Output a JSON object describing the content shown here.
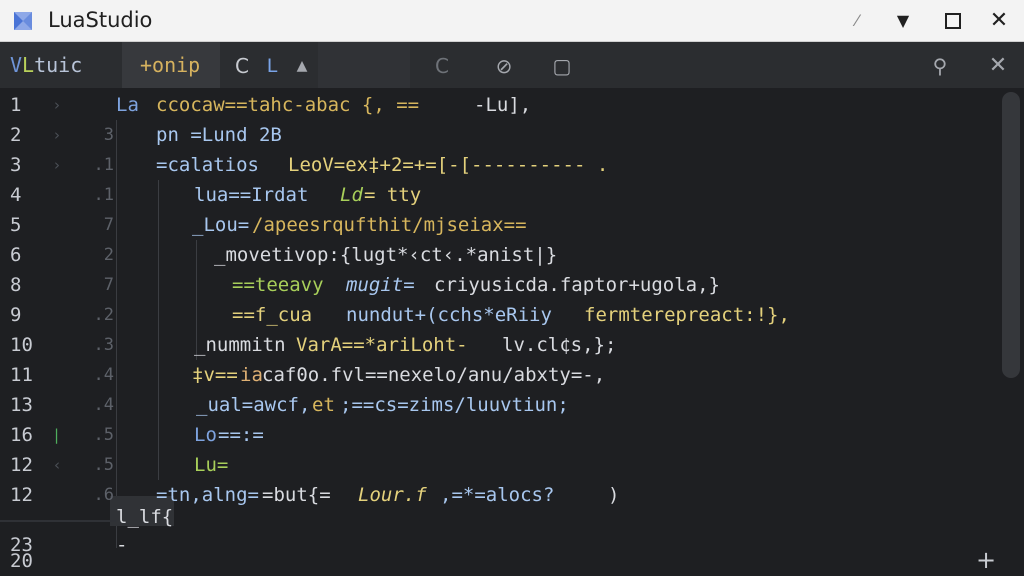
{
  "titlebar": {
    "title": "LuaStudio",
    "pin_glyph": "⁄",
    "dropdown_glyph": "▼",
    "close_glyph": "✕",
    "colors": {
      "background": "#f3f3f3",
      "logo_front": "#4a74d6",
      "logo_back": "#8ea8e8"
    }
  },
  "toolbar": {
    "tab_lua": {
      "v": "V",
      "lu": "L",
      "rest": "tuic"
    },
    "tab_active": "+onip",
    "tools": {
      "c_glyph": "C",
      "l_glyph": "L",
      "arrow_glyph": "▲",
      "undo_glyph": "C",
      "search_glyph": "⊘",
      "doc_glyph": "▢",
      "settings_glyph": "⚲",
      "close_glyph": "✕"
    }
  },
  "editor": {
    "rows": [
      {
        "ln": "1",
        "fold": "›",
        "sub": "",
        "segments": [
          "La",
          "ccocaw==tahc-abac {, ==",
          "-Lu],"
        ]
      },
      {
        "ln": "2",
        "fold": "›",
        "sub": "3",
        "segments": [
          "pn =Lund 2B"
        ]
      },
      {
        "ln": "3",
        "fold": "›",
        "sub": ".1",
        "segments": [
          "=calatios",
          "LeoV=ex‡+2=+=[-[---------- ."
        ]
      },
      {
        "ln": "4",
        "fold": "",
        "sub": ".1",
        "segments": [
          "lua==Irdat",
          "Ld",
          "= tty"
        ]
      },
      {
        "ln": "5",
        "fold": "",
        "sub": "7",
        "segments": [
          "_Lou=",
          "/apeesrqufthit/mjseiax=="
        ]
      },
      {
        "ln": "6",
        "fold": "",
        "sub": "2",
        "segments": [
          "_movetivop:{lugt*‹ct‹.*anist|}"
        ]
      },
      {
        "ln": "8",
        "fold": "",
        "sub": "7",
        "segments": [
          "==teeavy",
          "mugit=",
          "criyusicda.faptor+ugola,}"
        ]
      },
      {
        "ln": "9",
        "fold": "",
        "sub": ".2",
        "segments": [
          "==f_cua",
          "nundut+(cchs*eRiiy",
          "fermterepreact:!},"
        ]
      },
      {
        "ln": "10",
        "fold": "",
        "sub": ".3",
        "segments": [
          "_nummitn",
          "VarA==*ariLoht-",
          "lv.cl¢s,};"
        ]
      },
      {
        "ln": "11",
        "fold": "",
        "sub": ".4",
        "segments": [
          "‡v==",
          "ia",
          "caf0o.fvl==nexelo/anu/abxty=-,"
        ]
      },
      {
        "ln": "13",
        "fold": "",
        "sub": ".4",
        "segments": [
          "_ual=awcf,",
          "et",
          ";==cs=zims/luuvtiun;"
        ]
      },
      {
        "ln": "16",
        "fold": "|",
        "sub": ".5",
        "segments": [
          "Lo",
          "==:="
        ]
      },
      {
        "ln": "12",
        "fold": "‹",
        "sub": ".5",
        "segments": [
          "Lu="
        ]
      },
      {
        "ln": "12",
        "fold": "",
        "sub": ".6",
        "segments": [
          "=tn,alng=",
          "=but{=",
          "Lour.f",
          ",=*=alocs?",
          ")"
        ]
      },
      {
        "ln": "",
        "fold": "",
        "sub": "",
        "segments": [
          "l_lf{"
        ]
      },
      {
        "ln": "23",
        "fold": "",
        "sub": "",
        "segments": [
          "-"
        ]
      },
      {
        "ln": "20",
        "fold": "",
        "sub": "",
        "segments": [
          ""
        ]
      }
    ],
    "add_glyph": "+"
  }
}
